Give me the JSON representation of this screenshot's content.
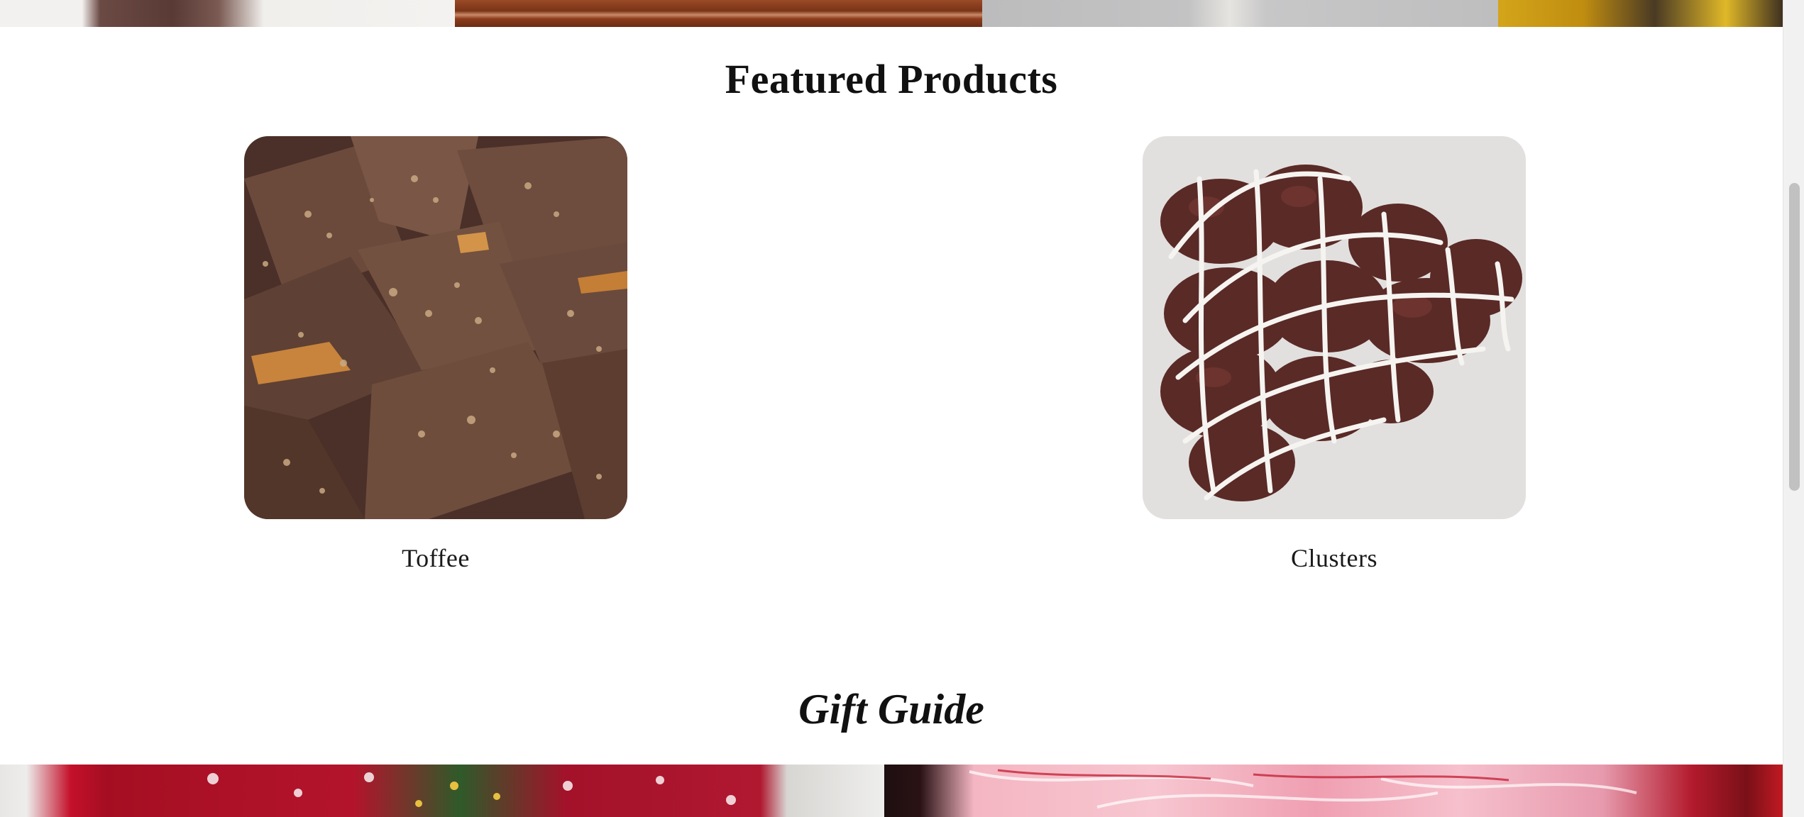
{
  "featured": {
    "title": "Featured Products",
    "products": [
      {
        "label": "Toffee"
      },
      {
        "label": "Clusters"
      }
    ]
  },
  "gift_guide": {
    "title": "Gift Guide"
  },
  "colors": {
    "background": "#ffffff",
    "heading_text": "#111111",
    "chocolate": "#5b3a2e",
    "white_drizzle": "#f4f2ef",
    "scrollbar_thumb": "#c1c1c1"
  }
}
